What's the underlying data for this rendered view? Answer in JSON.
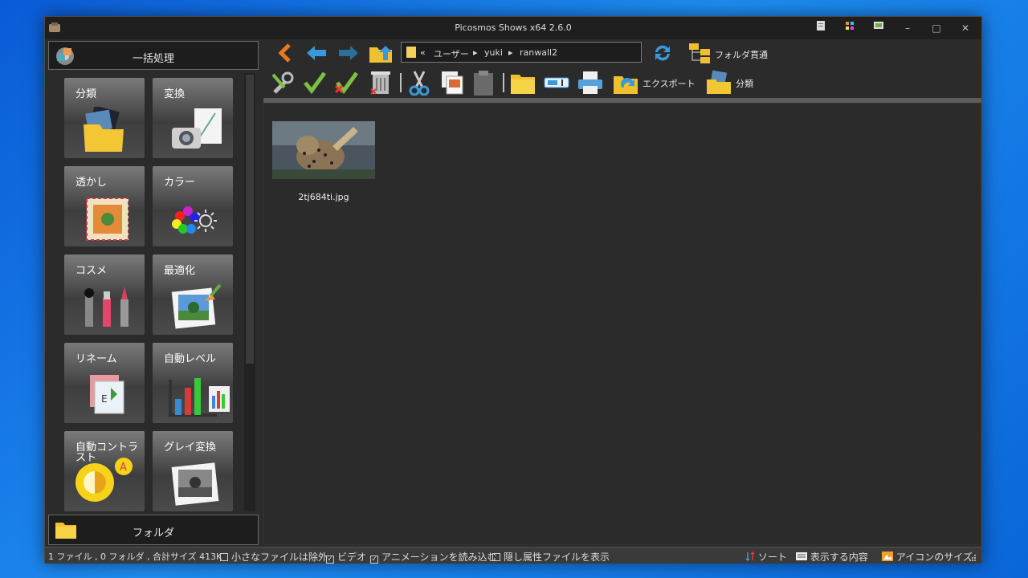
{
  "window": {
    "title": "Picosmos Shows x64 2.6.0"
  },
  "titlebar_buttons": {
    "minimize": "–",
    "maximize": "□",
    "close": "✕"
  },
  "left_panel": {
    "header_label": "一括処理",
    "tiles": [
      {
        "id": "classify",
        "label": "分類"
      },
      {
        "id": "convert",
        "label": "変換"
      },
      {
        "id": "watermark",
        "label": "透かし"
      },
      {
        "id": "color",
        "label": "カラー"
      },
      {
        "id": "cosme",
        "label": "コスメ"
      },
      {
        "id": "optimize",
        "label": "最適化"
      },
      {
        "id": "rename",
        "label": "リネーム"
      },
      {
        "id": "autolevel",
        "label": "自動レベル"
      },
      {
        "id": "autocontrast",
        "label": "自動コントラスト"
      },
      {
        "id": "grayscale",
        "label": "グレイ変換"
      }
    ],
    "footer_label": "フォルダ"
  },
  "nav": {
    "path": {
      "prefix": "«",
      "segments": [
        "ユーザー",
        "yuki",
        "ranwall2"
      ],
      "separator": "▸"
    },
    "folder_through_label": "フォルダ貫通"
  },
  "toolbar": {
    "export_label": "エクスポート",
    "classify_label": "分類"
  },
  "files": [
    {
      "name": "2tj684ti.jpg"
    }
  ],
  "status": {
    "summary": "1 ファイル , 0 フォルダ , 合計サイズ 413K",
    "options": [
      {
        "label": "小さなファイルは除外",
        "checked": false
      },
      {
        "label": "ビデオ",
        "checked": true
      },
      {
        "label": "アニメーションを読み込む",
        "checked": true
      },
      {
        "label": "隠し属性ファイルを表示",
        "checked": false
      }
    ],
    "sort_label": "ソート",
    "display_label": "表示する内容",
    "iconsize_label": "アイコンのサイズ"
  },
  "colors": {
    "accent_orange": "#e87a1e",
    "nav_blue": "#3a9ad9",
    "check_green": "#7ac143"
  }
}
